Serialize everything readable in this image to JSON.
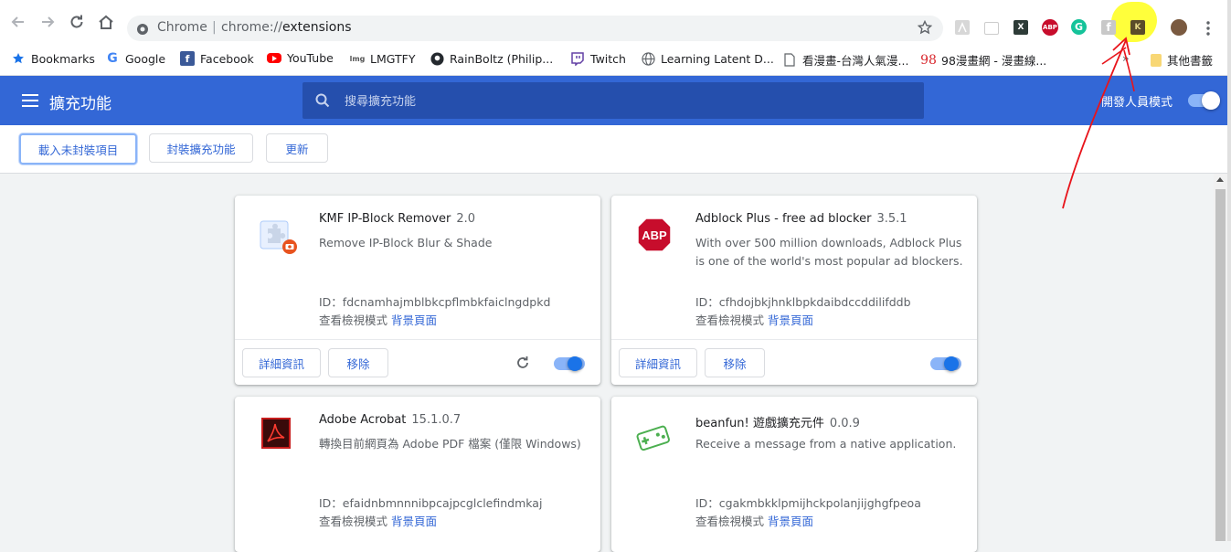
{
  "browser": {
    "omnibox_label": "Chrome",
    "url_scheme": "chrome://",
    "url_path": "extensions",
    "toolbar_icons": [
      "back-icon",
      "forward-icon",
      "reload-icon",
      "home-icon",
      "bookmark-star-icon",
      "pdf-extension-icon",
      "ticket-extension-icon",
      "x-extension-icon",
      "abp-extension-icon",
      "grammarly-extension-icon",
      "facebook-extension-icon",
      "kmf-extension-icon",
      "profile-avatar",
      "menu-icon"
    ],
    "abp_icon_text": "ABP",
    "grammarly_icon_text": "G",
    "x_icon_text": "X",
    "kmf_icon_text": "K"
  },
  "bookmarks": {
    "items": [
      {
        "label": "Bookmarks"
      },
      {
        "label": "Google"
      },
      {
        "label": "Facebook"
      },
      {
        "label": "YouTube"
      },
      {
        "label": "LMGTFY"
      },
      {
        "label": "RainBoltz (Philip..."
      },
      {
        "label": "Twitch"
      },
      {
        "label": "Learning Latent D..."
      },
      {
        "label": "看漫畫-台灣人氣漫..."
      },
      {
        "label": "98漫畫網 - 漫畫線..."
      }
    ],
    "lmgtfy_icon_text": "lmg",
    "site98_icon_text": "98",
    "overflow": "»",
    "other_label": "其他書籤"
  },
  "header": {
    "title": "擴充功能",
    "search_placeholder": "搜尋擴充功能",
    "devmode_label": "開發人員模式",
    "devmode_on": true
  },
  "actions": {
    "load_unpacked": "載入未封裝項目",
    "pack": "封裝擴充功能",
    "update": "更新"
  },
  "extensions": [
    {
      "name": "KMF IP-Block Remover",
      "version": "2.0",
      "description": "Remove IP-Block Blur & Shade",
      "id_label": "ID：fdcnamhajmblbkcpflmbkfaiclngdpkd",
      "inspect_label": "查看檢視模式",
      "inspect_link": "背景頁面",
      "details_label": "詳細資訊",
      "remove_label": "移除",
      "enabled": true
    },
    {
      "name": "Adblock Plus - free ad blocker",
      "version": "3.5.1",
      "description": "With over 500 million downloads, Adblock Plus is one of the world's most popular ad blockers.",
      "id_label": "ID：cfhdojbkjhnklbpkdaibdccddilifddb",
      "inspect_label": "查看檢視模式",
      "inspect_link": "背景頁面",
      "details_label": "詳細資訊",
      "remove_label": "移除",
      "enabled": true,
      "logo_text": "ABP"
    },
    {
      "name": "Adobe Acrobat",
      "version": "15.1.0.7",
      "description": "轉換目前網頁為 Adobe PDF 檔案 (僅限 Windows)",
      "id_label": "ID：efaidnbmnnnibpcajpcglclefindmkaj",
      "inspect_label": "查看檢視模式",
      "inspect_link": "背景頁面"
    },
    {
      "name": "beanfun! 遊戲擴充元件",
      "version": "0.0.9",
      "description": "Receive a message from a native application.",
      "id_label": "ID：cgakmbkklpmijhckpolanjijghgfpeoa",
      "inspect_label": "查看檢視模式",
      "inspect_link": "背景頁面"
    }
  ],
  "colors": {
    "header_blue": "#3367d6",
    "search_blue": "#254fad",
    "toggle_knob": "#1a73e8",
    "toggle_track": "#8ab4f8",
    "highlight_yellow": "#ffff3b",
    "annotation_red": "#e8141b"
  }
}
